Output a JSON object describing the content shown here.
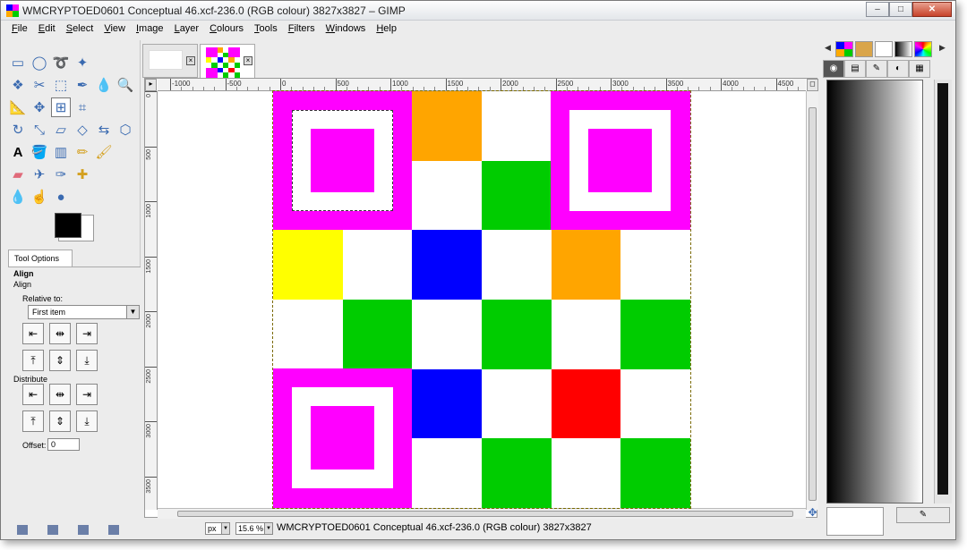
{
  "window": {
    "title": "WMCRYPTOED0601 Conceptual 46.xcf-236.0 (RGB colour) 3827x3827 – GIMP",
    "buttons": {
      "minimize": "–",
      "maximize": "□",
      "close": "✕"
    }
  },
  "menu": [
    "File",
    "Edit",
    "Select",
    "View",
    "Image",
    "Layer",
    "Colours",
    "Tools",
    "Filters",
    "Windows",
    "Help"
  ],
  "toolbox": {
    "tools": [
      "rect-select-icon",
      "ellipse-select-icon",
      "free-select-icon",
      "fuzzy-select-icon",
      "",
      "",
      "select-by-color-icon",
      "scissors-icon",
      "foreground-select-icon",
      "paths-icon",
      "color-picker-icon",
      "zoom-icon",
      "measure-icon",
      "move-icon",
      "align-icon",
      "crop-icon",
      "",
      "",
      "rotate-icon",
      "scale-icon",
      "shear-icon",
      "perspective-icon",
      "flip-icon",
      "cage-icon",
      "text-icon",
      "bucket-fill-icon",
      "blend-icon",
      "pencil-icon",
      "paintbrush-icon",
      "",
      "eraser-icon",
      "airbrush-icon",
      "ink-icon",
      "heal-icon",
      "",
      "",
      "blur-icon",
      "smudge-icon",
      "dodge-burn-icon",
      "",
      "",
      ""
    ],
    "active_tool": "align-icon",
    "fg_color": "#000000",
    "bg_color": "#ffffff"
  },
  "tool_options": {
    "tab_label": "Tool Options",
    "header": "Align",
    "section_align": "Align",
    "relative_label": "Relative to:",
    "relative_value": "First item",
    "distribute_label": "Distribute",
    "offset_label": "Offset:",
    "offset_value": "0"
  },
  "canvas": {
    "ruler_top_labels": [
      "-1000",
      "-500",
      "0",
      "500",
      "1000",
      "1500",
      "2000",
      "2500",
      "3000",
      "3500",
      "4000",
      "4500"
    ],
    "ruler_left_labels": [
      "0",
      "500",
      "1000",
      "1500",
      "2000",
      "2500",
      "3000",
      "3500"
    ],
    "grid": [
      [
        "#ff00ff",
        "#ff00ff",
        "#ffa500",
        "#ffffff",
        "#ff00ff",
        "#ff00ff"
      ],
      [
        "#ff00ff",
        "#ff00ff",
        "#ffffff",
        "#00cc00",
        "#ff00ff",
        "#ff00ff"
      ],
      [
        "#ffff00",
        "#ffffff",
        "#0000ff",
        "#ffffff",
        "#ffa500",
        "#ffffff"
      ],
      [
        "#ffffff",
        "#00cc00",
        "#ffffff",
        "#00cc00",
        "#ffffff",
        "#00cc00"
      ],
      [
        "#ff00ff",
        "#ff00ff",
        "#0000ff",
        "#ffffff",
        "#ff0000",
        "#ffffff"
      ],
      [
        "#ff00ff",
        "#ff00ff",
        "#ffffff",
        "#00cc00",
        "#ffffff",
        "#00cc00"
      ]
    ],
    "finder_color": "#ff00ff"
  },
  "statusbar": {
    "unit": "px",
    "zoom": "15.6 %",
    "text": "WMCRYPTOED0601 Conceptual 46.xcf-236.0 (RGB colour) 3827x3827"
  }
}
